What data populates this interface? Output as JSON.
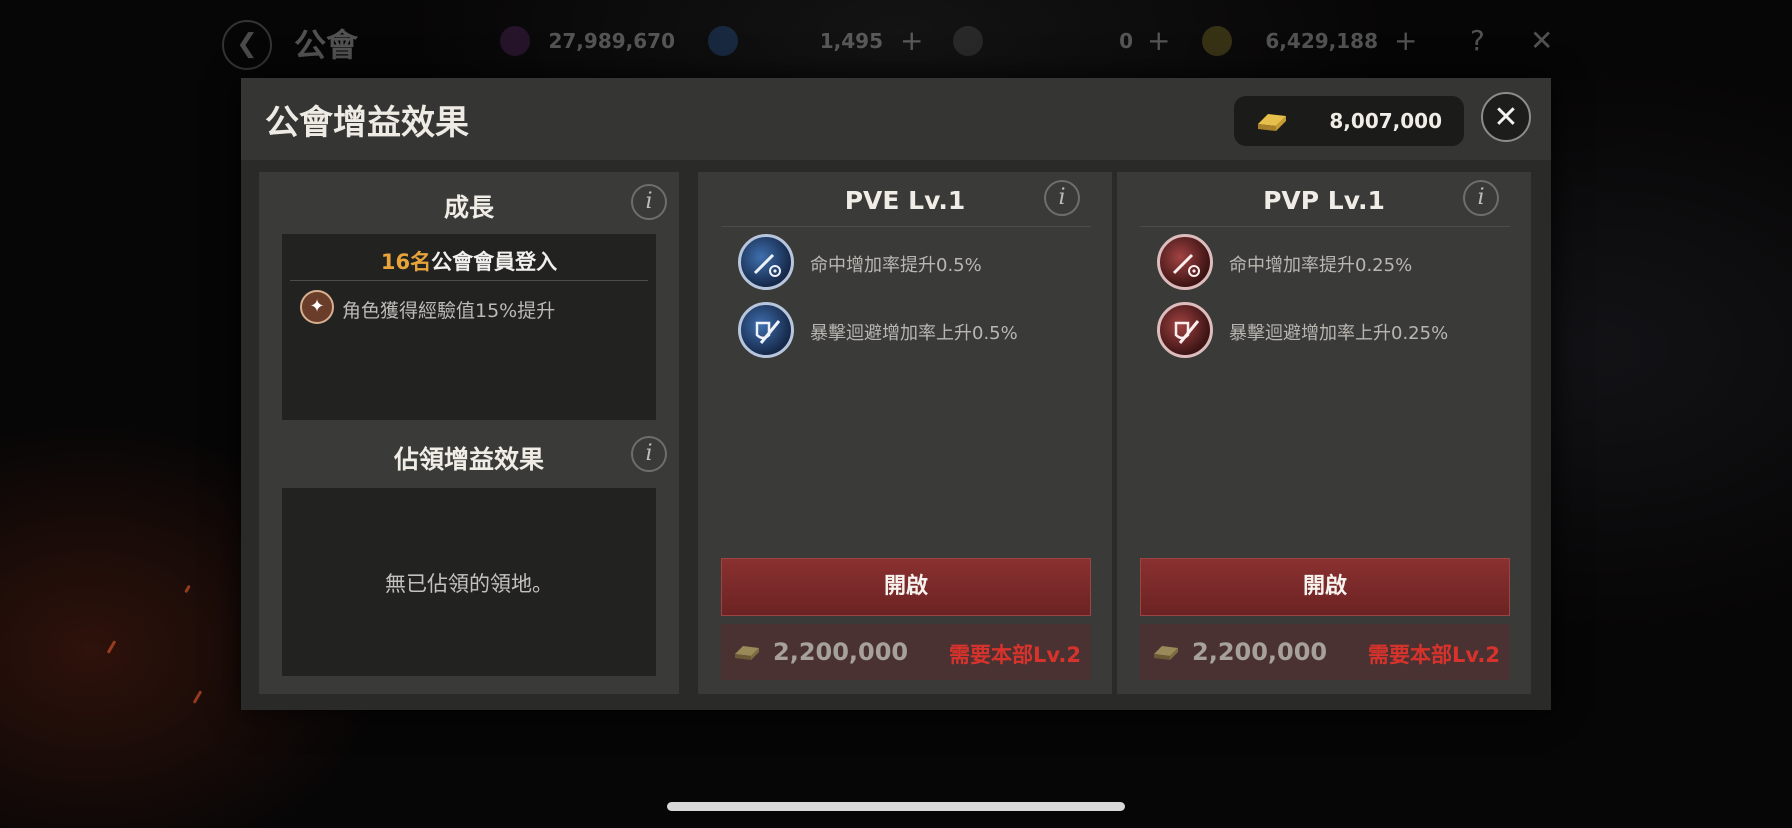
{
  "top_bar": {
    "back_icon": "back-arrow-icon",
    "title": "公會",
    "currencies": [
      {
        "icon": "purple-gem-icon",
        "value": "27,989,670",
        "plus": ""
      },
      {
        "icon": "diamond-icon",
        "value": "1,495",
        "plus": "+"
      },
      {
        "icon": "ticket-icon",
        "value": "0",
        "plus": "+"
      },
      {
        "icon": "gold-coin-icon",
        "value": "6,429,188",
        "plus": "+"
      }
    ],
    "help_label": "?",
    "close_label": "✕"
  },
  "modal": {
    "title": "公會增益效果",
    "gold_value": "8,007,000",
    "close_label": "✕"
  },
  "growth": {
    "title": "成長",
    "info_label": "i",
    "login_count": "16名",
    "login_suffix": "公會會員登入",
    "effect": "角色獲得經驗值15%提升"
  },
  "occupation": {
    "title": "佔領增益效果",
    "info_label": "i",
    "empty_text": "無已佔領的領地。"
  },
  "pve": {
    "title": "PVE Lv.1",
    "info_label": "i",
    "effects": [
      {
        "icon": "sword-target-icon",
        "text": "命中增加率提升0.5%"
      },
      {
        "icon": "sword-shield-icon",
        "text": "暴擊迴避增加率上升0.5%"
      }
    ],
    "open_label": "開啟",
    "cost": "2,200,000",
    "requirement": "需要本部Lv.2"
  },
  "pvp": {
    "title": "PVP Lv.1",
    "info_label": "i",
    "effects": [
      {
        "icon": "sword-target-icon",
        "text": "命中增加率提升0.25%"
      },
      {
        "icon": "sword-shield-icon",
        "text": "暴擊迴避增加率上升0.25%"
      }
    ],
    "open_label": "開啟",
    "cost": "2,200,000",
    "requirement": "需要本部Lv.2"
  },
  "colors": {
    "accent_orange": "#e8a33a",
    "button_red": "#7a2929",
    "requirement_red": "#d8322c"
  }
}
